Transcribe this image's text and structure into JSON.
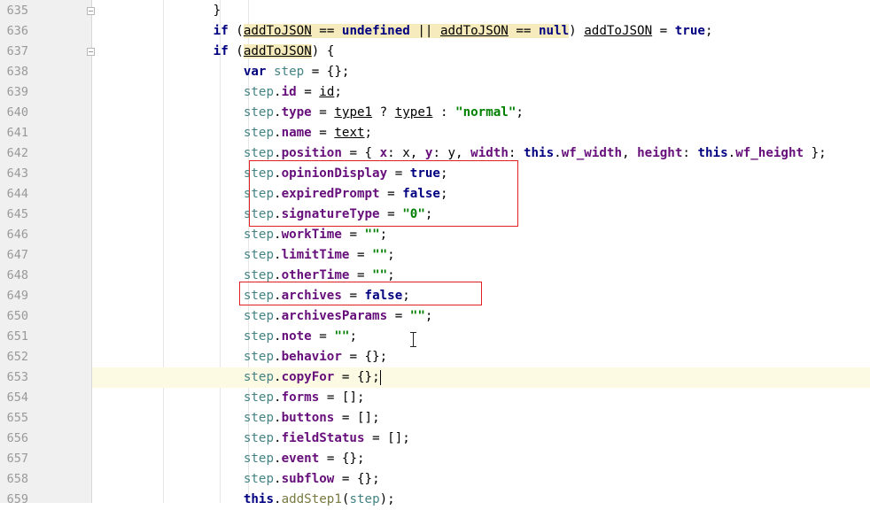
{
  "editor": {
    "current_line": "653",
    "lines": [
      {
        "num": "635",
        "tokens": [
          {
            "t": "                ",
            "c": "p"
          },
          {
            "t": "}",
            "c": "p"
          }
        ]
      },
      {
        "num": "636",
        "tokens": [
          {
            "t": "                ",
            "c": "p"
          },
          {
            "t": "if",
            "c": "kw"
          },
          {
            "t": " (",
            "c": "p"
          },
          {
            "t": "addToJSON",
            "c": "u hl"
          },
          {
            "t": " == ",
            "c": "hl"
          },
          {
            "t": "undefined",
            "c": "kw hl"
          },
          {
            "t": " || ",
            "c": "hl"
          },
          {
            "t": "addToJSON",
            "c": "u hl"
          },
          {
            "t": " == ",
            "c": "hl"
          },
          {
            "t": "null",
            "c": "kw hl"
          },
          {
            "t": ") ",
            "c": "p"
          },
          {
            "t": "addToJSON",
            "c": "u"
          },
          {
            "t": " = ",
            "c": "p"
          },
          {
            "t": "true",
            "c": "kw"
          },
          {
            "t": ";",
            "c": "p"
          }
        ]
      },
      {
        "num": "637",
        "tokens": [
          {
            "t": "                ",
            "c": "p"
          },
          {
            "t": "if",
            "c": "kw"
          },
          {
            "t": " (",
            "c": "p"
          },
          {
            "t": "addToJSON",
            "c": "u hl"
          },
          {
            "t": ") {",
            "c": "p"
          }
        ]
      },
      {
        "num": "638",
        "tokens": [
          {
            "t": "                    ",
            "c": "p"
          },
          {
            "t": "var",
            "c": "kw"
          },
          {
            "t": " ",
            "c": "p"
          },
          {
            "t": "step",
            "c": "v"
          },
          {
            "t": " = {};",
            "c": "p"
          }
        ]
      },
      {
        "num": "639",
        "tokens": [
          {
            "t": "                    ",
            "c": "p"
          },
          {
            "t": "step",
            "c": "v"
          },
          {
            "t": ".",
            "c": "p"
          },
          {
            "t": "id",
            "c": "f"
          },
          {
            "t": " = ",
            "c": "p"
          },
          {
            "t": "id",
            "c": "u"
          },
          {
            "t": ";",
            "c": "p"
          }
        ]
      },
      {
        "num": "640",
        "tokens": [
          {
            "t": "                    ",
            "c": "p"
          },
          {
            "t": "step",
            "c": "v"
          },
          {
            "t": ".",
            "c": "p"
          },
          {
            "t": "type",
            "c": "f"
          },
          {
            "t": " = ",
            "c": "p"
          },
          {
            "t": "type1",
            "c": "u"
          },
          {
            "t": " ? ",
            "c": "p"
          },
          {
            "t": "type1",
            "c": "u"
          },
          {
            "t": " : ",
            "c": "p"
          },
          {
            "t": "\"normal\"",
            "c": "s"
          },
          {
            "t": ";",
            "c": "p"
          }
        ]
      },
      {
        "num": "641",
        "tokens": [
          {
            "t": "                    ",
            "c": "p"
          },
          {
            "t": "step",
            "c": "v"
          },
          {
            "t": ".",
            "c": "p"
          },
          {
            "t": "name",
            "c": "f"
          },
          {
            "t": " = ",
            "c": "p"
          },
          {
            "t": "text",
            "c": "u"
          },
          {
            "t": ";",
            "c": "p"
          }
        ]
      },
      {
        "num": "642",
        "tokens": [
          {
            "t": "                    ",
            "c": "p"
          },
          {
            "t": "step",
            "c": "v"
          },
          {
            "t": ".",
            "c": "p"
          },
          {
            "t": "position",
            "c": "f"
          },
          {
            "t": " = { ",
            "c": "p"
          },
          {
            "t": "x",
            "c": "f"
          },
          {
            "t": ": x, ",
            "c": "p"
          },
          {
            "t": "y",
            "c": "f"
          },
          {
            "t": ": y, ",
            "c": "p"
          },
          {
            "t": "width",
            "c": "f"
          },
          {
            "t": ": ",
            "c": "p"
          },
          {
            "t": "this",
            "c": "kw"
          },
          {
            "t": ".",
            "c": "p"
          },
          {
            "t": "wf_width",
            "c": "f"
          },
          {
            "t": ", ",
            "c": "p"
          },
          {
            "t": "height",
            "c": "f"
          },
          {
            "t": ": ",
            "c": "p"
          },
          {
            "t": "this",
            "c": "kw"
          },
          {
            "t": ".",
            "c": "p"
          },
          {
            "t": "wf_height",
            "c": "f"
          },
          {
            "t": " };",
            "c": "p"
          }
        ]
      },
      {
        "num": "643",
        "tokens": [
          {
            "t": "                    ",
            "c": "p"
          },
          {
            "t": "step",
            "c": "v"
          },
          {
            "t": ".",
            "c": "p"
          },
          {
            "t": "opinionDisplay",
            "c": "f"
          },
          {
            "t": " = ",
            "c": "p"
          },
          {
            "t": "true",
            "c": "kw"
          },
          {
            "t": ";",
            "c": "p"
          }
        ]
      },
      {
        "num": "644",
        "tokens": [
          {
            "t": "                    ",
            "c": "p"
          },
          {
            "t": "step",
            "c": "v"
          },
          {
            "t": ".",
            "c": "p"
          },
          {
            "t": "expiredPrompt",
            "c": "f"
          },
          {
            "t": " = ",
            "c": "p"
          },
          {
            "t": "false",
            "c": "kw"
          },
          {
            "t": ";",
            "c": "p"
          }
        ]
      },
      {
        "num": "645",
        "tokens": [
          {
            "t": "                    ",
            "c": "p"
          },
          {
            "t": "step",
            "c": "v"
          },
          {
            "t": ".",
            "c": "p"
          },
          {
            "t": "signatureType",
            "c": "f"
          },
          {
            "t": " = ",
            "c": "p"
          },
          {
            "t": "\"0\"",
            "c": "s"
          },
          {
            "t": ";",
            "c": "p"
          }
        ]
      },
      {
        "num": "646",
        "tokens": [
          {
            "t": "                    ",
            "c": "p"
          },
          {
            "t": "step",
            "c": "v"
          },
          {
            "t": ".",
            "c": "p"
          },
          {
            "t": "workTime",
            "c": "f"
          },
          {
            "t": " = ",
            "c": "p"
          },
          {
            "t": "\"\"",
            "c": "s"
          },
          {
            "t": ";",
            "c": "p"
          }
        ]
      },
      {
        "num": "647",
        "tokens": [
          {
            "t": "                    ",
            "c": "p"
          },
          {
            "t": "step",
            "c": "v"
          },
          {
            "t": ".",
            "c": "p"
          },
          {
            "t": "limitTime",
            "c": "f"
          },
          {
            "t": " = ",
            "c": "p"
          },
          {
            "t": "\"\"",
            "c": "s"
          },
          {
            "t": ";",
            "c": "p"
          }
        ]
      },
      {
        "num": "648",
        "tokens": [
          {
            "t": "                    ",
            "c": "p"
          },
          {
            "t": "step",
            "c": "v"
          },
          {
            "t": ".",
            "c": "p"
          },
          {
            "t": "otherTime",
            "c": "f"
          },
          {
            "t": " = ",
            "c": "p"
          },
          {
            "t": "\"\"",
            "c": "s"
          },
          {
            "t": ";",
            "c": "p"
          }
        ]
      },
      {
        "num": "649",
        "tokens": [
          {
            "t": "                    ",
            "c": "p"
          },
          {
            "t": "step",
            "c": "v"
          },
          {
            "t": ".",
            "c": "p"
          },
          {
            "t": "archives",
            "c": "f"
          },
          {
            "t": " = ",
            "c": "p"
          },
          {
            "t": "false",
            "c": "kw"
          },
          {
            "t": ";",
            "c": "p"
          }
        ]
      },
      {
        "num": "650",
        "tokens": [
          {
            "t": "                    ",
            "c": "p"
          },
          {
            "t": "step",
            "c": "v"
          },
          {
            "t": ".",
            "c": "p"
          },
          {
            "t": "archivesParams",
            "c": "f"
          },
          {
            "t": " = ",
            "c": "p"
          },
          {
            "t": "\"\"",
            "c": "s"
          },
          {
            "t": ";",
            "c": "p"
          }
        ]
      },
      {
        "num": "651",
        "tokens": [
          {
            "t": "                    ",
            "c": "p"
          },
          {
            "t": "step",
            "c": "v"
          },
          {
            "t": ".",
            "c": "p"
          },
          {
            "t": "note",
            "c": "f"
          },
          {
            "t": " = ",
            "c": "p"
          },
          {
            "t": "\"\"",
            "c": "s"
          },
          {
            "t": ";",
            "c": "p"
          }
        ]
      },
      {
        "num": "652",
        "tokens": [
          {
            "t": "                    ",
            "c": "p"
          },
          {
            "t": "step",
            "c": "v"
          },
          {
            "t": ".",
            "c": "p"
          },
          {
            "t": "behavior",
            "c": "f"
          },
          {
            "t": " = {};",
            "c": "p"
          }
        ]
      },
      {
        "num": "653",
        "tokens": [
          {
            "t": "                    ",
            "c": "p"
          },
          {
            "t": "step",
            "c": "v"
          },
          {
            "t": ".",
            "c": "p"
          },
          {
            "t": "copyFor",
            "c": "f"
          },
          {
            "t": " = {};",
            "c": "p"
          }
        ]
      },
      {
        "num": "654",
        "tokens": [
          {
            "t": "                    ",
            "c": "p"
          },
          {
            "t": "step",
            "c": "v"
          },
          {
            "t": ".",
            "c": "p"
          },
          {
            "t": "forms",
            "c": "f"
          },
          {
            "t": " = [];",
            "c": "p"
          }
        ]
      },
      {
        "num": "655",
        "tokens": [
          {
            "t": "                    ",
            "c": "p"
          },
          {
            "t": "step",
            "c": "v"
          },
          {
            "t": ".",
            "c": "p"
          },
          {
            "t": "buttons",
            "c": "f"
          },
          {
            "t": " = [];",
            "c": "p"
          }
        ]
      },
      {
        "num": "656",
        "tokens": [
          {
            "t": "                    ",
            "c": "p"
          },
          {
            "t": "step",
            "c": "v"
          },
          {
            "t": ".",
            "c": "p"
          },
          {
            "t": "fieldStatus",
            "c": "f"
          },
          {
            "t": " = [];",
            "c": "p"
          }
        ]
      },
      {
        "num": "657",
        "tokens": [
          {
            "t": "                    ",
            "c": "p"
          },
          {
            "t": "step",
            "c": "v"
          },
          {
            "t": ".",
            "c": "p"
          },
          {
            "t": "event",
            "c": "f"
          },
          {
            "t": " = {};",
            "c": "p"
          }
        ]
      },
      {
        "num": "658",
        "tokens": [
          {
            "t": "                    ",
            "c": "p"
          },
          {
            "t": "step",
            "c": "v"
          },
          {
            "t": ".",
            "c": "p"
          },
          {
            "t": "subflow",
            "c": "f"
          },
          {
            "t": " = {};",
            "c": "p"
          }
        ]
      },
      {
        "num": "659",
        "tokens": [
          {
            "t": "                    ",
            "c": "p"
          },
          {
            "t": "this",
            "c": "kw"
          },
          {
            "t": ".",
            "c": "p"
          },
          {
            "t": "addStep1",
            "c": "m"
          },
          {
            "t": "(",
            "c": "p"
          },
          {
            "t": "step",
            "c": "v"
          },
          {
            "t": ");",
            "c": "p"
          }
        ]
      }
    ]
  },
  "colors": {
    "keyword": "#000080",
    "field": "#660e7a",
    "string": "#008000",
    "variable": "#458383",
    "highlight": "#f6ebbc",
    "current_line_bg": "#fcfae3",
    "annotation_box": "#e02020"
  }
}
